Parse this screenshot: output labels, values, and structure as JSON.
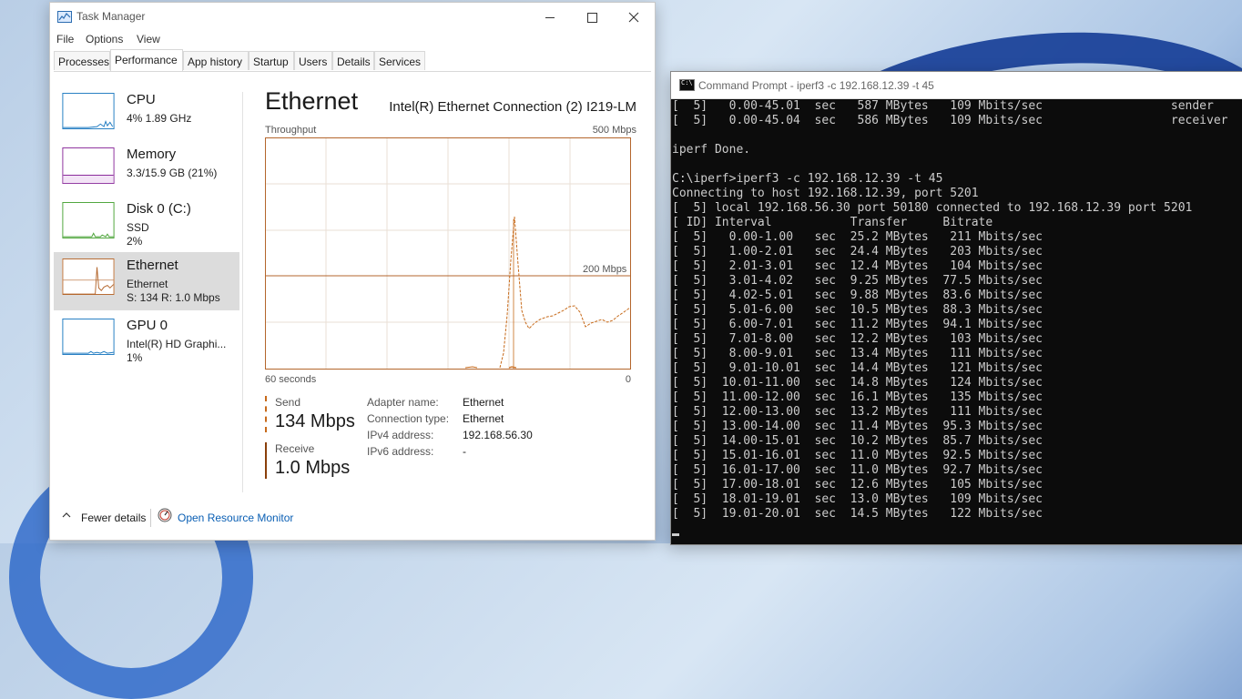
{
  "task_manager": {
    "title": "Task Manager",
    "menu": [
      "File",
      "Options",
      "View"
    ],
    "tabs": [
      "Processes",
      "Performance",
      "App history",
      "Startup",
      "Users",
      "Details",
      "Services"
    ],
    "active_tab": "Performance",
    "sidebar": [
      {
        "name": "CPU",
        "line1": "4%  1.89 GHz",
        "color": "#1f7bc1"
      },
      {
        "name": "Memory",
        "line1": "3.3/15.9 GB (21%)",
        "color": "#8b2c9b"
      },
      {
        "name": "Disk 0 (C:)",
        "line1": "SSD",
        "line2": "2%",
        "color": "#4aa337"
      },
      {
        "name": "Ethernet",
        "line1": "Ethernet",
        "line2": "S: 134  R: 1.0 Mbps",
        "color": "#b4662c"
      },
      {
        "name": "GPU 0",
        "line1": "Intel(R) HD Graphi...",
        "line2": "1%",
        "color": "#1f7bc1"
      }
    ],
    "main": {
      "title": "Ethernet",
      "device": "Intel(R) Ethernet Connection (2) I219-LM",
      "graph_label": "Throughput",
      "graph_max": "500 Mbps",
      "graph_mid": "200 Mbps",
      "graph_time": "60 seconds",
      "graph_min": "0",
      "send_label": "Send",
      "send_value": "134 Mbps",
      "receive_label": "Receive",
      "receive_value": "1.0 Mbps",
      "properties": [
        {
          "key": "Adapter name:",
          "value": "Ethernet"
        },
        {
          "key": "Connection type:",
          "value": "Ethernet"
        },
        {
          "key": "IPv4 address:",
          "value": "192.168.56.30"
        },
        {
          "key": "IPv6 address:",
          "value": "-"
        }
      ]
    },
    "footer": {
      "fewer_details": "Fewer details",
      "open_resource_monitor": "Open Resource Monitor"
    },
    "accent_color": "#c76a1a"
  },
  "command_prompt": {
    "title": "Command Prompt - iperf3  -c 192.168.12.39 -t 45",
    "lines": [
      "[  5]   0.00-45.01  sec   587 MBytes   109 Mbits/sec                  sender",
      "[  5]   0.00-45.04  sec   586 MBytes   109 Mbits/sec                  receiver",
      "",
      "iperf Done.",
      "",
      "C:\\iperf>iperf3 -c 192.168.12.39 -t 45",
      "Connecting to host 192.168.12.39, port 5201",
      "[  5] local 192.168.56.30 port 50180 connected to 192.168.12.39 port 5201",
      "[ ID] Interval           Transfer     Bitrate",
      "[  5]   0.00-1.00   sec  25.2 MBytes   211 Mbits/sec",
      "[  5]   1.00-2.01   sec  24.4 MBytes   203 Mbits/sec",
      "[  5]   2.01-3.01   sec  12.4 MBytes   104 Mbits/sec",
      "[  5]   3.01-4.02   sec  9.25 MBytes  77.5 Mbits/sec",
      "[  5]   4.02-5.01   sec  9.88 MBytes  83.6 Mbits/sec",
      "[  5]   5.01-6.00   sec  10.5 MBytes  88.3 Mbits/sec",
      "[  5]   6.00-7.01   sec  11.2 MBytes  94.1 Mbits/sec",
      "[  5]   7.01-8.00   sec  12.2 MBytes   103 Mbits/sec",
      "[  5]   8.00-9.01   sec  13.4 MBytes   111 Mbits/sec",
      "[  5]   9.01-10.01  sec  14.4 MBytes   121 Mbits/sec",
      "[  5]  10.01-11.00  sec  14.8 MBytes   124 Mbits/sec",
      "[  5]  11.00-12.00  sec  16.1 MBytes   135 Mbits/sec",
      "[  5]  12.00-13.00  sec  13.2 MBytes   111 Mbits/sec",
      "[  5]  13.00-14.00  sec  11.4 MBytes  95.3 Mbits/sec",
      "[  5]  14.00-15.01  sec  10.2 MBytes  85.7 Mbits/sec",
      "[  5]  15.01-16.01  sec  11.0 MBytes  92.5 Mbits/sec",
      "[  5]  16.01-17.00  sec  11.0 MBytes  92.7 Mbits/sec",
      "[  5]  17.00-18.01  sec  12.6 MBytes   105 Mbits/sec",
      "[  5]  18.01-19.01  sec  13.0 MBytes   109 Mbits/sec",
      "[  5]  19.01-20.01  sec  14.5 MBytes   122 Mbits/sec"
    ]
  }
}
